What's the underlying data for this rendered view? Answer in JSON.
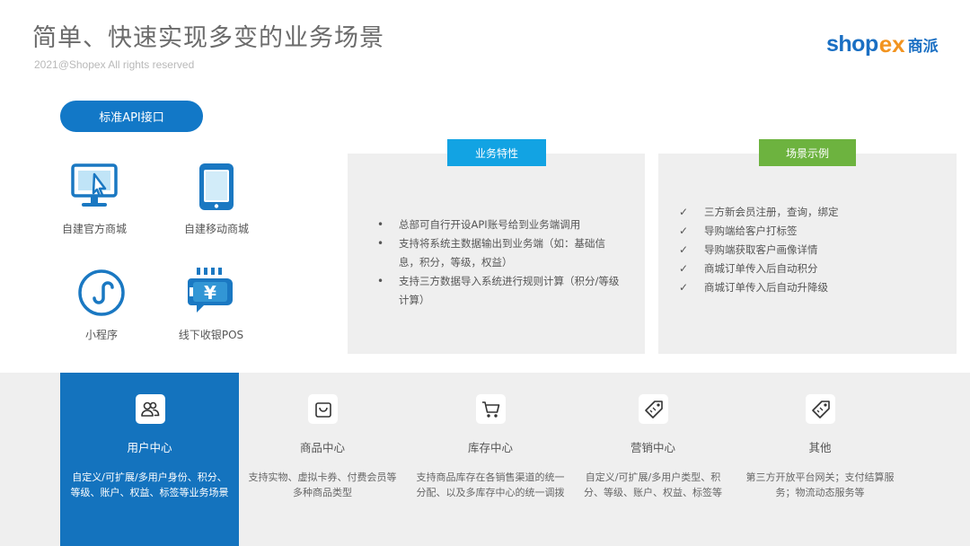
{
  "header": {
    "title": "简单、快速实现多变的业务场景",
    "copyright": "2021@Shopex All rights reserved",
    "logo": {
      "word": "shop",
      "x": "ex",
      "cn": "商派"
    }
  },
  "api_button": {
    "label": "标准API接口"
  },
  "channels": [
    {
      "label": "自建官方商城",
      "icon": "monitor-cursor-icon"
    },
    {
      "label": "自建移动商城",
      "icon": "tablet-icon"
    },
    {
      "label": "小程序",
      "icon": "mini-program-icon"
    },
    {
      "label": "线下收银POS",
      "icon": "pos-terminal-icon"
    }
  ],
  "features": {
    "tag": "业务特性",
    "items": [
      "总部可自行开设API账号给到业务端调用",
      "支持将系统主数据输出到业务端（如：基础信息，积分，等级，权益）",
      "支持三方数据导入系统进行规则计算（积分/等级计算）"
    ]
  },
  "scenarios": {
    "tag": "场景示例",
    "items": [
      "三方新会员注册，查询，绑定",
      "导购端给客户打标签",
      "导购端获取客户画像详情",
      "商城订单传入后自动积分",
      "商城订单传入后自动升降级"
    ]
  },
  "centers": [
    {
      "title": "用户中心",
      "desc": "自定义/可扩展/多用户身份、积分、等级、账户、权益、标签等业务场景",
      "icon": "users-icon",
      "active": true
    },
    {
      "title": "商品中心",
      "desc": "支持实物、虚拟卡券、付费会员等多种商品类型",
      "icon": "shopping-bag-icon",
      "active": false
    },
    {
      "title": "库存中心",
      "desc": "支持商品库存在各销售渠道的统一分配、以及多库存中心的统一调拨",
      "icon": "cart-icon",
      "active": false
    },
    {
      "title": "营销中心",
      "desc": "自定义/可扩展/多用户类型、积分、等级、账户、权益、标签等",
      "icon": "tag-icon",
      "active": false
    },
    {
      "title": "其他",
      "desc": "第三方开放平台网关；支付结算服务；物流动态服务等",
      "icon": "tag-icon",
      "active": false
    }
  ],
  "colors": {
    "primary_blue": "#1278c7",
    "tag_blue": "#12a3e3",
    "tag_green": "#6db33f",
    "panel_gray": "#efefef",
    "logo_orange": "#f29420"
  }
}
